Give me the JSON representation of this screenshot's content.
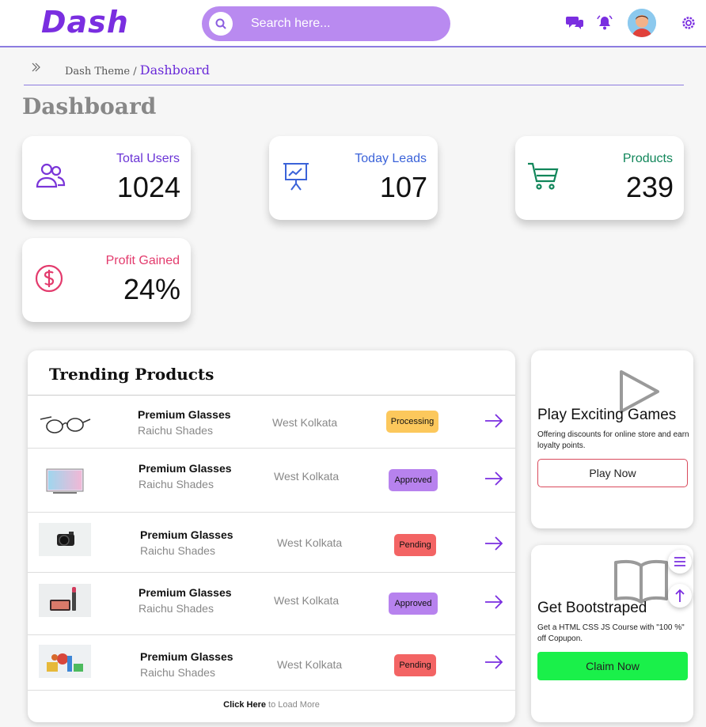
{
  "app": {
    "logo": "Dash"
  },
  "search": {
    "placeholder": "Search here..."
  },
  "header": {
    "icons": [
      "chat-icon",
      "bell-icon",
      "avatar",
      "gear-icon"
    ]
  },
  "breadcrumb": {
    "parent": "Dash Theme",
    "separator": " / ",
    "current": "Dashboard"
  },
  "page": {
    "title": "Dashboard"
  },
  "stats": [
    {
      "label": "Total Users",
      "value": "1024",
      "color": "#6b35d6",
      "icon": "users-icon"
    },
    {
      "label": "Today Leads",
      "value": "107",
      "color": "#3b63d9",
      "icon": "presentation-chart-icon"
    },
    {
      "label": "Products",
      "value": "239",
      "color": "#11865a",
      "icon": "cart-icon"
    },
    {
      "label": "Profit Gained",
      "value": "24%",
      "color": "#e33b6d",
      "icon": "dollar-icon"
    }
  ],
  "trending": {
    "title": "Trending Products",
    "rows": [
      {
        "thumb": "glasses-image",
        "name": "Premium Glasses",
        "brand": "Raichu Shades",
        "location": "West Kolkata",
        "status": "Processing",
        "status_color": "#fcc85c"
      },
      {
        "thumb": "tv-image",
        "name": "Premium Glasses",
        "brand": "Raichu Shades",
        "location": "West Kolkata",
        "status": "Approved",
        "status_color": "#b782ee"
      },
      {
        "thumb": "camera-image",
        "name": "Premium Glasses",
        "brand": "Raichu Shades",
        "location": "West Kolkata",
        "status": "Pending",
        "status_color": "#f36464"
      },
      {
        "thumb": "makeup-image",
        "name": "Premium Glasses",
        "brand": "Raichu Shades",
        "location": "West Kolkata",
        "status": "Approved",
        "status_color": "#b782ee"
      },
      {
        "thumb": "toys-image",
        "name": "Premium Glasses",
        "brand": "Raichu Shades",
        "location": "West Kolkata",
        "status": "Pending",
        "status_color": "#f36464"
      }
    ],
    "load_more_link": "Click Here",
    "load_more_text": " to Load More"
  },
  "promos": [
    {
      "title": "Play Exciting Games",
      "description": "Offering discounts for online store and earn loyalty points.",
      "button": "Play Now",
      "icon": "play-icon"
    },
    {
      "title": "Get Bootstraped",
      "description": "Get a HTML CSS JS Course with \"100 %\" off Copupon.",
      "button": "Claim Now",
      "icon": "book-icon"
    }
  ],
  "fabs": [
    "menu-icon",
    "arrow-up-icon"
  ],
  "colors": {
    "accent": "#7a2ee0",
    "search_bg": "#b98af0",
    "header_line": "#8c7ce0",
    "green_button": "#1af04a"
  }
}
